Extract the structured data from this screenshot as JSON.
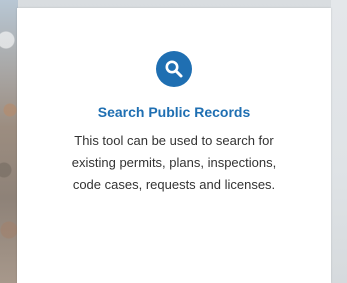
{
  "card": {
    "icon": "search-icon",
    "title": "Search Public Records",
    "description_lines": [
      "This tool can be used to search for",
      "existing permits, plans, inspections,",
      "code cases, requests and licenses."
    ]
  },
  "colors": {
    "accent": "#1f6fb2",
    "text": "#333333",
    "card_bg": "#ffffff"
  }
}
